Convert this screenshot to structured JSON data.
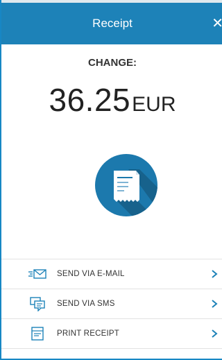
{
  "header": {
    "title": "Receipt",
    "close_glyph": "✕"
  },
  "summary": {
    "label": "CHANGE:",
    "amount": "36.25",
    "currency": "EUR"
  },
  "badge": {
    "icon": "receipt-icon"
  },
  "actions": [
    {
      "label": "SEND VIA E-MAIL",
      "icon": "email-icon"
    },
    {
      "label": "SEND VIA SMS",
      "icon": "sms-icon"
    },
    {
      "label": "PRINT RECEIPT",
      "icon": "printer-icon"
    }
  ],
  "colors": {
    "accent": "#1d82b8",
    "badge": "#1c79ad",
    "chevron": "#1d82b8"
  }
}
